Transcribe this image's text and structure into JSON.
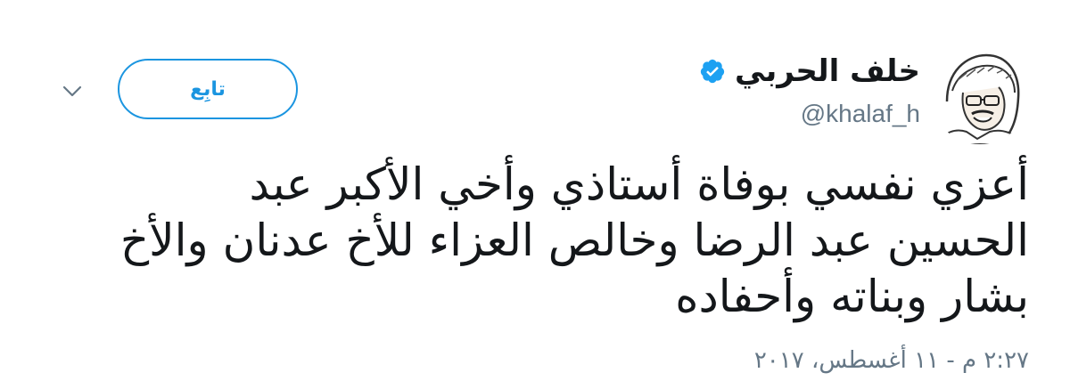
{
  "author": {
    "name": "خلف الحربي",
    "handle": "@khalaf_h",
    "verified": true,
    "verified_color": "#1da1f2"
  },
  "actions": {
    "follow_label": "تابِع",
    "more_icon": "chevron-down-icon"
  },
  "tweet": {
    "lines": [
      "أعزي نفسي بوفاة أستاذي وأخي الأكبر عبد",
      "الحسين عبد الرضا وخالص العزاء للأخ عدنان والأخ",
      "بشار وبناته وأحفاده"
    ],
    "timestamp": "٢:٢٧ م - ١١ أغسطس، ٢٠١٧"
  },
  "colors": {
    "accent": "#1b95e0",
    "text": "#14171a",
    "secondary_text": "#657786"
  }
}
